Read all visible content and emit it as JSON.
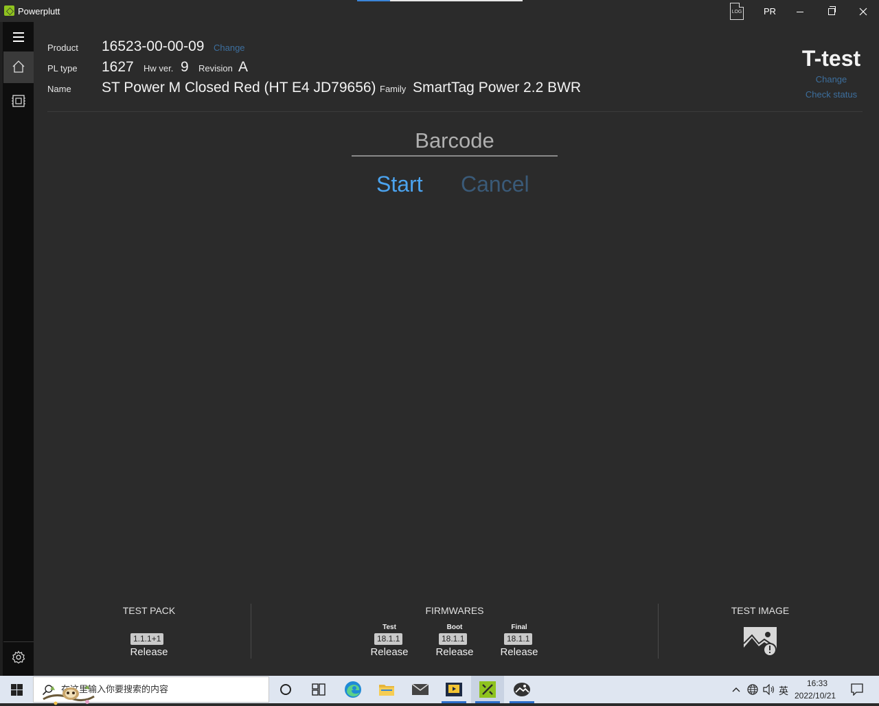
{
  "window": {
    "title": "Powerplutt",
    "log_icon_label": "LOG",
    "user_initials": "PR",
    "progress_fraction": 0.2
  },
  "product": {
    "product_label": "Product",
    "product_value": "16523-00-00-09",
    "product_change": "Change",
    "pl_type_label": "PL type",
    "pl_type_value": "1627",
    "hw_ver_label": "Hw ver.",
    "hw_ver_value": "9",
    "revision_label": "Revision",
    "revision_value": "A",
    "name_label": "Name",
    "name_value": "ST Power M Closed Red (HT E4 JD79656)",
    "family_label": "Family",
    "family_value": "SmartTag Power 2.2 BWR"
  },
  "station": {
    "name": "T-test",
    "change": "Change",
    "check_status": "Check status"
  },
  "barcode": {
    "placeholder": "Barcode",
    "value": ""
  },
  "actions": {
    "start": "Start",
    "cancel": "Cancel"
  },
  "test_pack": {
    "title": "TEST PACK",
    "version": "1.1.1+1",
    "channel": "Release"
  },
  "firmwares": {
    "title": "FIRMWARES",
    "items": [
      {
        "tag": "Test",
        "version": "18.1.1",
        "channel": "Release"
      },
      {
        "tag": "Boot",
        "version": "18.1.1",
        "channel": "Release"
      },
      {
        "tag": "Final",
        "version": "18.1.1",
        "channel": "Release"
      }
    ]
  },
  "test_image": {
    "title": "TEST IMAGE",
    "icon": "image-warning-icon"
  },
  "taskbar": {
    "search_placeholder": "在这里输入你要搜索的内容",
    "ime": "英",
    "time": "16:33",
    "date": "2022/10/21"
  }
}
